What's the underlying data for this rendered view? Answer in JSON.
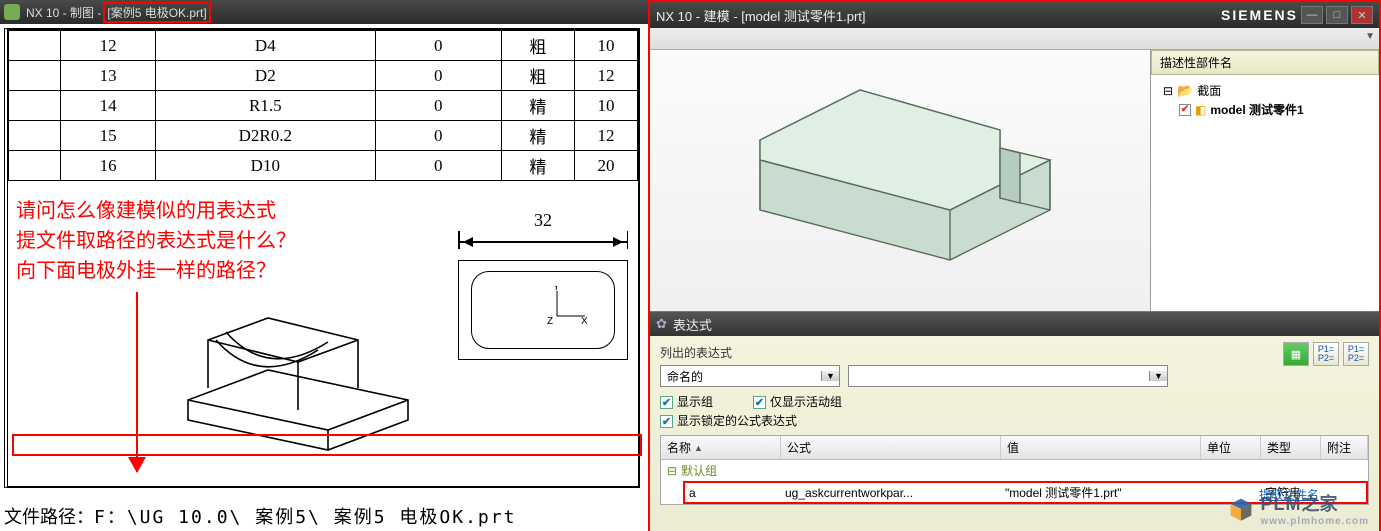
{
  "left": {
    "title_prefix": "NX 10 - 制图 -",
    "title_file": "[案例5 电极OK.prt]",
    "table": {
      "rows": [
        {
          "c1": "",
          "c2": "12",
          "c3": "D4",
          "c4": "0",
          "c5": "粗",
          "c6": "10"
        },
        {
          "c1": "",
          "c2": "13",
          "c3": "D2",
          "c4": "0",
          "c5": "粗",
          "c6": "12"
        },
        {
          "c1": "",
          "c2": "14",
          "c3": "R1.5",
          "c4": "0",
          "c5": "精",
          "c6": "10"
        },
        {
          "c1": "",
          "c2": "15",
          "c3": "D2R0.2",
          "c4": "0",
          "c5": "精",
          "c6": "12"
        },
        {
          "c1": "",
          "c2": "16",
          "c3": "D10",
          "c4": "0",
          "c5": "精",
          "c6": "20"
        }
      ]
    },
    "note_l1": "请问怎么像建模似的用表达式",
    "note_l2": "提文件取路径的表达式是什么？",
    "note_l3": "向下面电极外挂一样的路径？",
    "dim_value": "32",
    "axis_y": "Y",
    "axis_x": "X",
    "axis_z": "Z",
    "path_label": "文件路径：",
    "path_value": "F：\\UG  10.0\\ 案例5\\ 案例5  电极OK.prt"
  },
  "right": {
    "title": "NX 10 - 建模 - [model  测试零件1.prt]",
    "brand": "SIEMENS",
    "tree_header": "描述性部件名",
    "tree_folder": "截面",
    "tree_item": "model  测试零件1",
    "expr_title": "表达式",
    "list_label": "列出的表达式",
    "combo_value": "命名的",
    "chk_show_group": "显示组",
    "chk_active_only": "仅显示活动组",
    "chk_show_locked": "显示锁定的公式表达式",
    "col_name": "名称",
    "col_formula": "公式",
    "col_value": "值",
    "col_unit": "单位",
    "col_type": "类型",
    "col_note": "附注",
    "default_group": "默认组",
    "row_name": "a",
    "row_formula": "ug_askcurrentworkpar...",
    "row_value": "\"model  测试零件1.prt\"",
    "row_type": "字符串",
    "link_text": "提取文件名",
    "wm_main": "PLM",
    "wm_cn": "之家",
    "wm_url": "www.plmhome.com",
    "icon_p1": "P1=",
    "icon_p2": "P2="
  }
}
